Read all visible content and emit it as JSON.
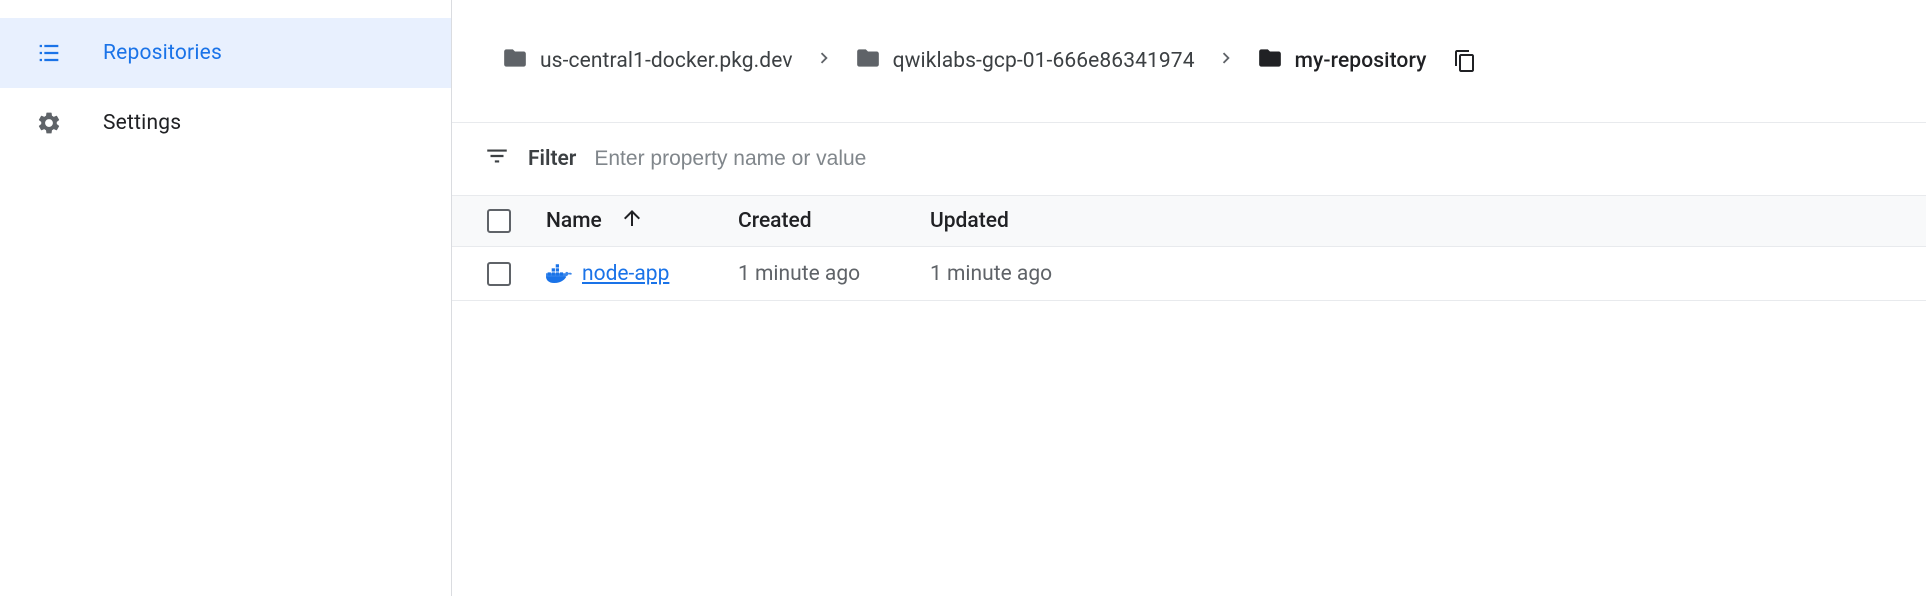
{
  "sidebar": {
    "items": [
      {
        "label": "Repositories",
        "active": true
      },
      {
        "label": "Settings",
        "active": false
      }
    ]
  },
  "breadcrumbs": {
    "items": [
      {
        "label": "us-central1-docker.pkg.dev",
        "current": false,
        "folderColor": "#5f6368"
      },
      {
        "label": "qwiklabs-gcp-01-666e86341974",
        "current": false,
        "folderColor": "#5f6368"
      },
      {
        "label": "my-repository",
        "current": true,
        "folderColor": "#202124"
      }
    ]
  },
  "filter": {
    "label": "Filter",
    "placeholder": "Enter property name or value"
  },
  "table": {
    "headers": {
      "name": "Name",
      "created": "Created",
      "updated": "Updated"
    },
    "rows": [
      {
        "name": "node-app",
        "created": "1 minute ago",
        "updated": "1 minute ago"
      }
    ]
  }
}
